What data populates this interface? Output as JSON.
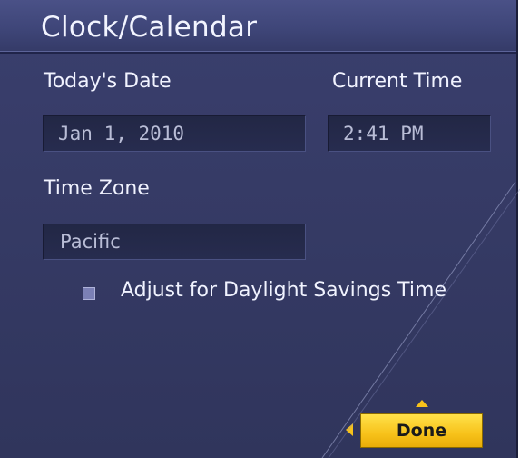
{
  "header": {
    "title": "Clock/Calendar"
  },
  "date": {
    "label": "Today's Date",
    "value": "Jan 1, 2010"
  },
  "time": {
    "label": "Current Time",
    "value": "2:41 PM"
  },
  "timezone": {
    "label": "Time Zone",
    "value": "Pacific"
  },
  "dst": {
    "label": "Adjust for Daylight Savings Time",
    "checked": false
  },
  "done_button": {
    "label": "Done"
  },
  "colors": {
    "panel": "#363b66",
    "title_bar": "#3f4679",
    "accent_button": "#f7c21a",
    "text": "#f1f3ff"
  }
}
